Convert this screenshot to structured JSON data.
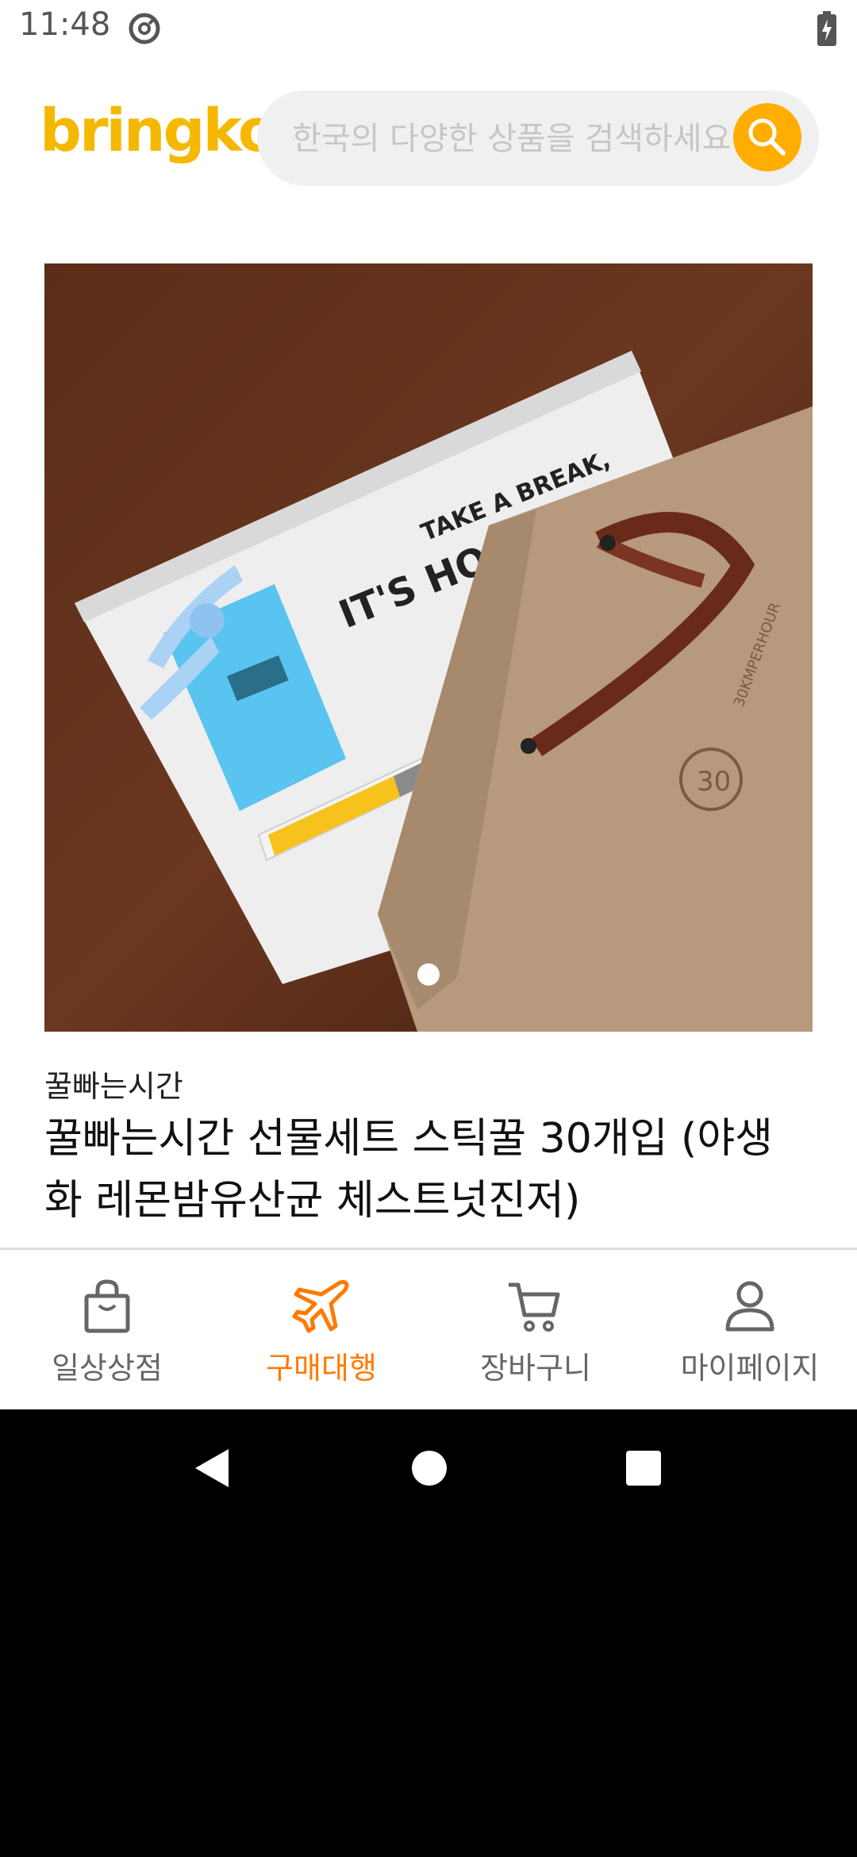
{
  "status_bar": {
    "time": "11:48",
    "icons": [
      "at-sign-icon",
      "battery-charging-icon"
    ]
  },
  "header": {
    "logo": "bringko",
    "search": {
      "placeholder": "한국의 다양한 상품을 검색하세요",
      "value": "",
      "button_icon": "search-icon"
    }
  },
  "product": {
    "image_alt": "TAKE A BREAK, IT'S HONEY TIME gift box",
    "carousel_dots": 1,
    "brand": "꿀빠는시간",
    "title": "꿀빠는시간 선물세트 스틱꿀 30개입 (야생화 레몬밤유산균 체스트넛진저)"
  },
  "bottom_nav": {
    "items": [
      {
        "label": "일상상점",
        "icon": "shopping-bag-icon",
        "active": false
      },
      {
        "label": "구매대행",
        "icon": "airplane-icon",
        "active": true
      },
      {
        "label": "장바구니",
        "icon": "cart-icon",
        "active": false
      },
      {
        "label": "마이페이지",
        "icon": "user-icon",
        "active": false
      }
    ]
  },
  "colors": {
    "brand": "#f5b800",
    "search_button": "#ffae00",
    "active_tab": "#ff7a00"
  }
}
